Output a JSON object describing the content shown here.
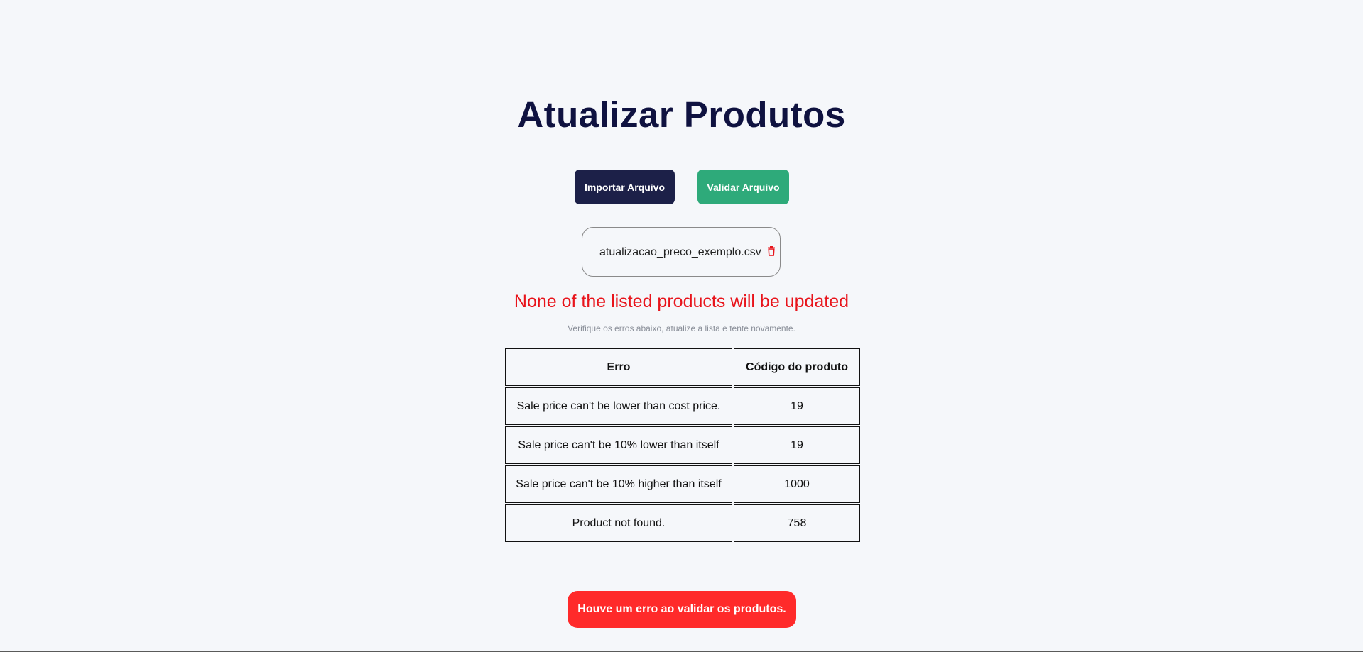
{
  "page": {
    "title": "Atualizar Produtos"
  },
  "actions": {
    "import_label": "Importar Arquivo",
    "validate_label": "Validar Arquivo"
  },
  "file": {
    "name": "atualizacao_preco_exemplo.csv",
    "delete_icon": "trash-icon"
  },
  "validation": {
    "headline": "None of the listed products will be updated",
    "hint": "Verifique os erros abaixo, atualize a lista e tente novamente."
  },
  "table": {
    "headers": [
      "Erro",
      "Código do produto"
    ],
    "rows": [
      [
        "Sale price can't be lower than cost price.",
        "19"
      ],
      [
        "Sale price can't be 10% lower than itself",
        "19"
      ],
      [
        "Sale price can't be 10% higher than itself",
        "1000"
      ],
      [
        "Product not found.",
        "758"
      ]
    ]
  },
  "toast": {
    "message": "Houve um erro ao validar os produtos."
  },
  "colors": {
    "title": "#0f1240",
    "import_button": "#1c2048",
    "validate_button": "#2eaa7a",
    "error_text": "#e8141b",
    "toast_bg": "#ff2a2a"
  }
}
